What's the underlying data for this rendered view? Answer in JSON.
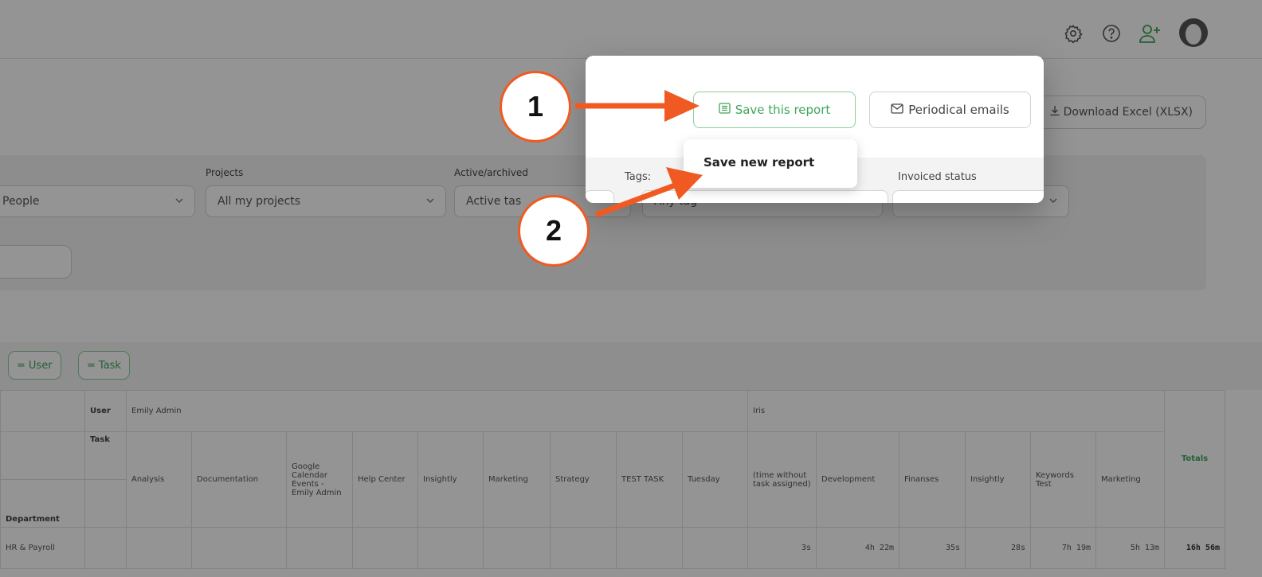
{
  "header": {
    "icons": [
      "gear-icon",
      "help-icon",
      "add-user-icon",
      "avatar"
    ]
  },
  "actions": {
    "download_label": "Download Excel (XLSX)"
  },
  "filters": {
    "people_value": "People",
    "projects_label": "Projects",
    "projects_value": "All my projects",
    "active_label": "Active/archived",
    "active_value": "Active tas",
    "tags_label": "Tags:",
    "tags_value": "Any tag",
    "invoiced_label": "Invoiced status"
  },
  "groupby": {
    "chips": [
      "User",
      "Task"
    ]
  },
  "popover": {
    "save_label": "Save this report",
    "periodical_label": "Periodical emails",
    "dropdown_item": "Save new report"
  },
  "annotations": {
    "step1": "1",
    "step2": "2",
    "accent": "#f05a22"
  },
  "table": {
    "row_user_label": "User",
    "row_task_label": "Task",
    "department_label": "Department",
    "users": [
      "Emily Admin",
      "Iris"
    ],
    "tasks": [
      "Analysis",
      "Documentation",
      "Google Calendar Events - Emily Admin",
      "Help Center",
      "Insightly",
      "Marketing",
      "Strategy",
      "TEST TASK",
      "Tuesday",
      "(time without task assigned)",
      "Development",
      "Finanses",
      "Insightly",
      "Keywords Test",
      "Marketing"
    ],
    "totals_label": "Totals",
    "rows": [
      {
        "department": "HR & Payroll",
        "values": [
          "",
          "",
          "",
          "",
          "",
          "",
          "",
          "",
          "",
          "3s",
          "4h 22m",
          "35s",
          "28s",
          "7h 19m",
          "5h 13m"
        ],
        "total": "16h 56m"
      }
    ]
  },
  "colors": {
    "green": "#3fa65a",
    "green_border": "#8ad19a",
    "overlay": "rgba(0,0,0,0.42)"
  }
}
